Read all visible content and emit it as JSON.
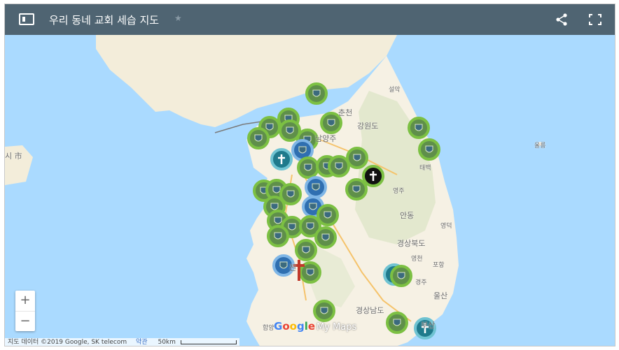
{
  "header": {
    "title": "우리 동네 교회 세습 지도",
    "star_icon": "star-icon",
    "share_icon": "share-icon",
    "fullscreen_icon": "fullscreen-icon",
    "panel_icon": "side-panel-icon"
  },
  "map": {
    "colors": {
      "sea": "#aadaff",
      "land": "#f6f1e4",
      "header": "#4f6472",
      "marker_green": "#7cc043",
      "marker_teal": "#1f7a8c"
    },
    "places": [
      {
        "name": "춘천",
        "small": false
      },
      {
        "name": "강원도",
        "small": false
      },
      {
        "name": "남양주",
        "small": false
      },
      {
        "name": "설악",
        "small": true
      },
      {
        "name": "울릉",
        "small": true
      },
      {
        "name": "태백",
        "small": true
      },
      {
        "name": "영주",
        "small": true
      },
      {
        "name": "안동",
        "small": false
      },
      {
        "name": "영덕",
        "small": true
      },
      {
        "name": "경상북도",
        "small": false
      },
      {
        "name": "영천",
        "small": true
      },
      {
        "name": "포항",
        "small": true
      },
      {
        "name": "경주",
        "small": true
      },
      {
        "name": "울산",
        "small": false
      },
      {
        "name": "경상남도",
        "small": false
      },
      {
        "name": "진",
        "small": false
      },
      {
        "name": "함양",
        "small": true
      },
      {
        "name": "부산",
        "small": false
      },
      {
        "name": "여수",
        "small": true
      },
      {
        "name": "시 市",
        "small": false
      }
    ]
  },
  "zoom": {
    "in_label": "+",
    "out_label": "−"
  },
  "attribution": {
    "data": "지도 데이터 ©2019 Google, SK telecom",
    "terms": "약관",
    "scale": "50km"
  },
  "brand": {
    "g": "G",
    "o1": "o",
    "o2": "o",
    "g2": "g",
    "l": "l",
    "e": "e",
    "mymaps": "My Maps"
  }
}
